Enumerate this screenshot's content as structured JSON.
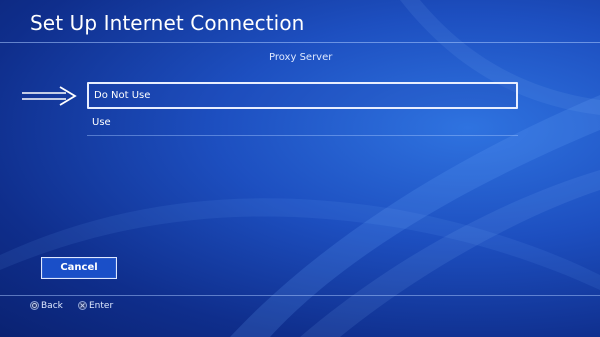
{
  "screen": {
    "title": "Set Up Internet Connection",
    "subtitle": "Proxy Server"
  },
  "options": [
    {
      "label": "Do Not Use",
      "selected": true
    },
    {
      "label": "Use",
      "selected": false
    }
  ],
  "buttons": {
    "cancel_label": "Cancel"
  },
  "footer": {
    "back_label": "Back",
    "back_icon": "circle-button-icon",
    "enter_label": "Enter",
    "enter_icon": "cross-button-icon"
  },
  "annotation": {
    "pointer_icon": "right-arrow-icon"
  },
  "colors": {
    "background_dark": "#0a2272",
    "background_light": "#2f73e0",
    "text": "#ffffff",
    "selection_border": "#e8eeff"
  }
}
